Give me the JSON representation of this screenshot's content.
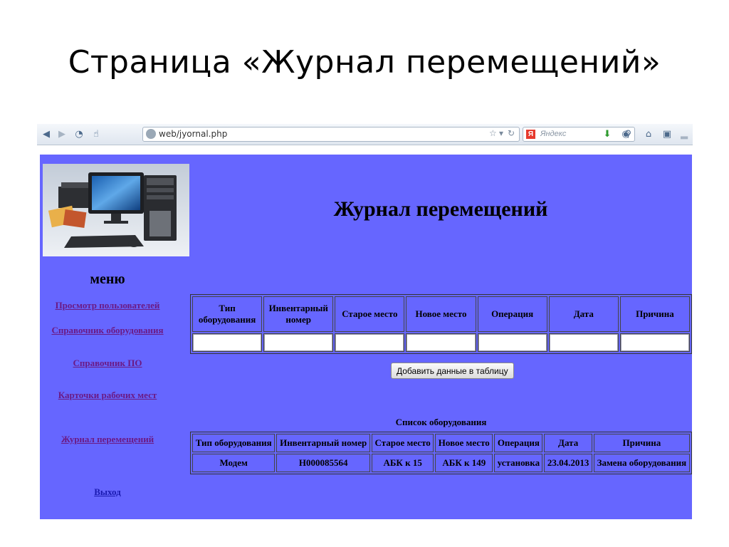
{
  "slide": {
    "title": "Страница «Журнал перемещений»"
  },
  "browser": {
    "url": "web/jyornal.php",
    "search_placeholder": "Яндекс",
    "search_engine_badge": "Я"
  },
  "page": {
    "heading": "Журнал перемещений",
    "menu": {
      "title": "меню",
      "items": [
        "Просмотр пользователей",
        "Справочник оборудования",
        "Справочник ПО",
        "Карточки рабочих мест",
        "Журнал перемещений",
        "Выход"
      ]
    },
    "entry_form": {
      "headers": [
        "Тип оборудования",
        "Инвентарный номер",
        "Старое место",
        "Новое место",
        "Операция",
        "Дата",
        "Причина"
      ],
      "values": [
        "",
        "",
        "",
        "",
        "",
        "",
        ""
      ],
      "add_button": "Добавить данные в таблицу"
    },
    "equipment_list": {
      "caption": "Список оборудования",
      "headers": [
        "Тип оборудования",
        "Инвентарный номер",
        "Старое место",
        "Новое место",
        "Операция",
        "Дата",
        "Причина"
      ],
      "rows": [
        [
          "Модем",
          "H000085564",
          "АБК к 15",
          "АБК к 149",
          "установка",
          "23.04.2013",
          "Замена оборудования"
        ]
      ]
    }
  }
}
